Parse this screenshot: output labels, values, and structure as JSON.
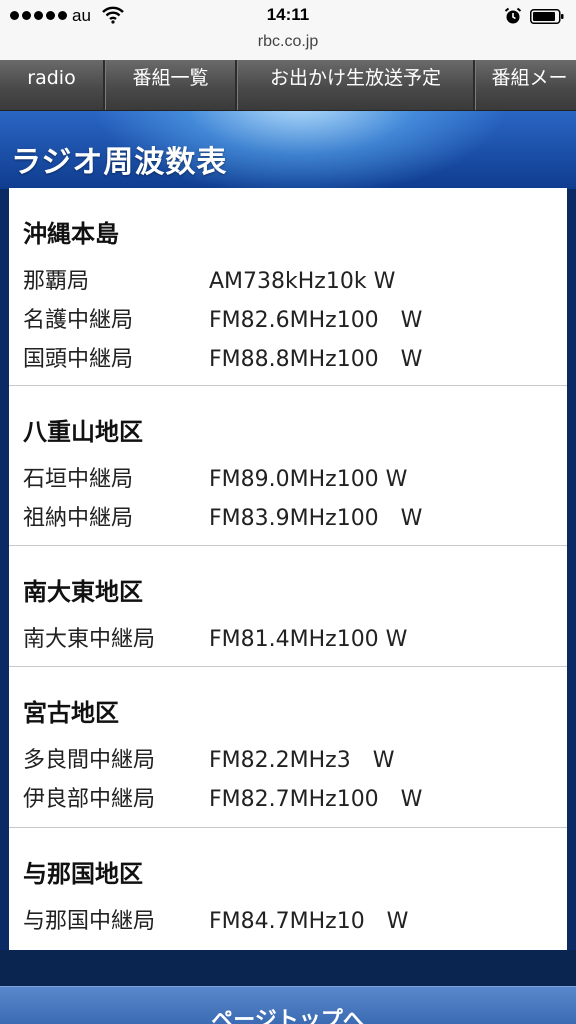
{
  "status_bar": {
    "carrier": "au",
    "time": "14:11"
  },
  "url_bar": {
    "url": "rbc.co.jp"
  },
  "nav": {
    "items": [
      {
        "label": "radio"
      },
      {
        "label": "番組一覧"
      },
      {
        "label": "お出かけ生放送予定"
      },
      {
        "label": "番組メー"
      }
    ]
  },
  "header": {
    "title": "ラジオ周波数表"
  },
  "sections": [
    {
      "region": "沖縄本島",
      "stations": [
        {
          "name": "那覇局",
          "freq": "AM738kHz10k W"
        },
        {
          "name": "名護中継局",
          "freq": "FM82.6MHz100　W"
        },
        {
          "name": "国頭中継局",
          "freq": "FM88.8MHz100　W"
        }
      ]
    },
    {
      "region": "八重山地区",
      "stations": [
        {
          "name": "石垣中継局",
          "freq": "FM89.0MHz100 W"
        },
        {
          "name": "祖納中継局",
          "freq": "FM83.9MHz100　W"
        }
      ]
    },
    {
      "region": "南大東地区",
      "stations": [
        {
          "name": "南大東中継局",
          "freq": "FM81.4MHz100 W"
        }
      ]
    },
    {
      "region": "宮古地区",
      "stations": [
        {
          "name": "多良間中継局",
          "freq": "FM82.2MHz3　W"
        },
        {
          "name": "伊良部中継局",
          "freq": "FM82.7MHz100　W"
        }
      ]
    },
    {
      "region": "与那国地区",
      "stations": [
        {
          "name": "与那国中継局",
          "freq": "FM84.7MHz10　W"
        }
      ]
    }
  ],
  "footer": {
    "page_top_label": "ページトップへ"
  },
  "colors": {
    "nav_bg": "#4a4a4a",
    "header_blue": "#2a66c4",
    "page_bg": "#0b2a63",
    "card_bg": "#ffffff"
  }
}
